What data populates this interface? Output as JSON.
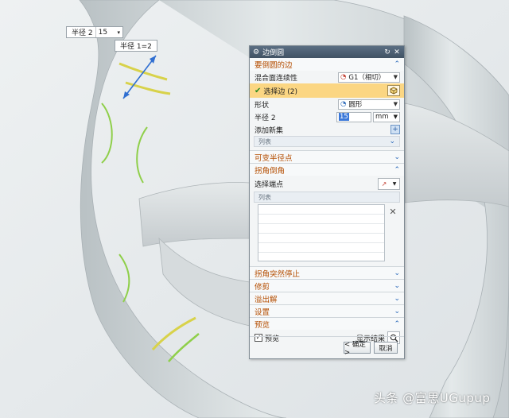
{
  "float": {
    "radius_label": "半径 2",
    "radius_value": "15",
    "radius_tag": "半径 1=2"
  },
  "dialog": {
    "title": "边倒圆",
    "sections": {
      "edges": {
        "title": "要倒圆的边",
        "blend_label": "混合面连续性",
        "blend_value": "G1（相切）",
        "select_edge": "选择边 (2)",
        "shape_label": "形状",
        "shape_value": "圆形",
        "radius_label": "半径 2",
        "radius_value": "15",
        "radius_unit": "mm",
        "add_set": "添加新集",
        "list_label": "列表"
      },
      "variable": {
        "title": "可变半径点"
      },
      "corner": {
        "title": "拐角倒角",
        "select_vertex": "选择端点",
        "list_label": "列表"
      },
      "corner_stop": {
        "title": "拐角突然停止"
      },
      "trim": {
        "title": "修剪"
      },
      "overflow": {
        "title": "溢出解"
      },
      "settings": {
        "title": "设置"
      },
      "preview": {
        "title": "预览",
        "preview_label": "预览",
        "show_result": "显示结果"
      }
    },
    "ok_label": "< 确定 >",
    "cancel_label": "取消"
  },
  "watermark": "头条 @富思UGupup",
  "colors": {
    "section_title": "#b44d00",
    "selected_row": "#fbd683",
    "titlebar": "#4a5c6e",
    "highlight_edge": "#d8d24a"
  }
}
